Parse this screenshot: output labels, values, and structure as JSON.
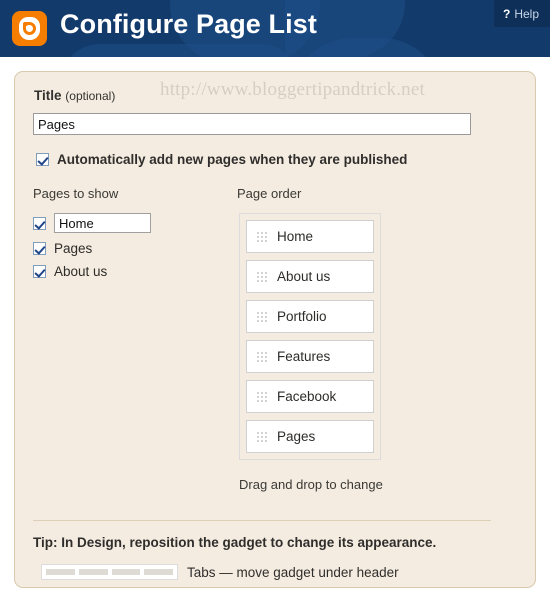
{
  "header": {
    "title": "Configure Page List",
    "logo_icon": "blogger-logo-icon",
    "help_label": "Help",
    "help_icon": "question-mark-icon",
    "bg_color": "#123a6b",
    "accent_color": "#f57d00"
  },
  "watermark": "http://www.bloggertipandtrick.net",
  "form": {
    "title_label_bold": "Title",
    "title_label_optional": "(optional)",
    "title_value": "Pages",
    "auto_add_label": "Automatically add new pages when they are published",
    "auto_add_checked": true
  },
  "pages_to_show": {
    "heading": "Pages to show",
    "items": [
      {
        "label": "Home",
        "checked": true,
        "editable": true
      },
      {
        "label": "Pages",
        "checked": true,
        "editable": false
      },
      {
        "label": "About us",
        "checked": true,
        "editable": false
      }
    ]
  },
  "page_order": {
    "heading": "Page order",
    "items": [
      {
        "label": "Home"
      },
      {
        "label": "About us"
      },
      {
        "label": "Portfolio"
      },
      {
        "label": "Features"
      },
      {
        "label": "Facebook"
      },
      {
        "label": "Pages"
      }
    ],
    "hint": "Drag and drop to change",
    "grip_icon": "drag-handle-icon"
  },
  "tip": {
    "text": "Tip: In Design, reposition the gadget to change its appearance.",
    "preview_icon": "tabs-layout-icon",
    "caption": "Tabs — move gadget under header"
  }
}
